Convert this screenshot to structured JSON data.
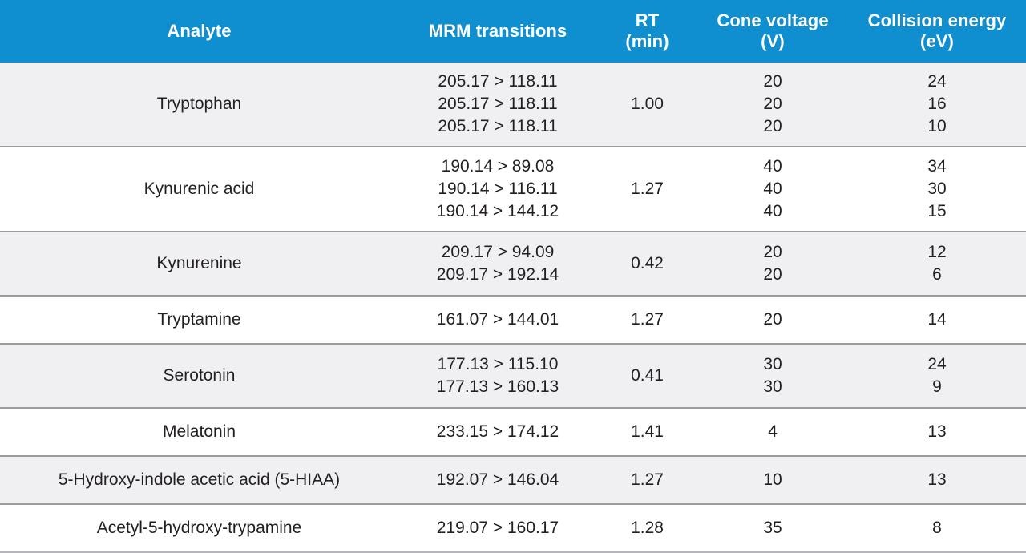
{
  "table": {
    "header": {
      "columns": [
        {
          "label": "Analyte",
          "unit": ""
        },
        {
          "label": "MRM transitions",
          "unit": ""
        },
        {
          "label": "RT",
          "unit": "(min)"
        },
        {
          "label": "Cone voltage",
          "unit": "(V)"
        },
        {
          "label": "Collision energy",
          "unit": "(eV)"
        }
      ]
    },
    "rows": [
      {
        "analyte": "Tryptophan",
        "mrm": [
          "205.17 > 118.11",
          "205.17 > 118.11",
          "205.17 > 118.11"
        ],
        "rt": "1.00",
        "cone_voltage": [
          "20",
          "20",
          "20"
        ],
        "collision_energy": [
          "24",
          "16",
          "10"
        ]
      },
      {
        "analyte": "Kynurenic acid",
        "mrm": [
          "190.14 > 89.08",
          "190.14 > 116.11",
          "190.14 > 144.12"
        ],
        "rt": "1.27",
        "cone_voltage": [
          "40",
          "40",
          "40"
        ],
        "collision_energy": [
          "34",
          "30",
          "15"
        ]
      },
      {
        "analyte": "Kynurenine",
        "mrm": [
          "209.17 > 94.09",
          "209.17 > 192.14"
        ],
        "rt": "0.42",
        "cone_voltage": [
          "20",
          "20"
        ],
        "collision_energy": [
          "12",
          "6"
        ]
      },
      {
        "analyte": "Tryptamine",
        "mrm": [
          "161.07 > 144.01"
        ],
        "rt": "1.27",
        "cone_voltage": [
          "20"
        ],
        "collision_energy": [
          "14"
        ]
      },
      {
        "analyte": "Serotonin",
        "mrm": [
          "177.13 > 115.10",
          "177.13 > 160.13"
        ],
        "rt": "0.41",
        "cone_voltage": [
          "30",
          "30"
        ],
        "collision_energy": [
          "24",
          "9"
        ]
      },
      {
        "analyte": "Melatonin",
        "mrm": [
          "233.15 > 174.12"
        ],
        "rt": "1.41",
        "cone_voltage": [
          "4"
        ],
        "collision_energy": [
          "13"
        ]
      },
      {
        "analyte": "5-Hydroxy-indole acetic acid (5-HIAA)",
        "mrm": [
          "192.07 > 146.04"
        ],
        "rt": "1.27",
        "cone_voltage": [
          "10"
        ],
        "collision_energy": [
          "13"
        ]
      },
      {
        "analyte": "Acetyl-5-hydroxy-trypamine",
        "mrm": [
          "219.07 > 160.17"
        ],
        "rt": "1.28",
        "cone_voltage": [
          "35"
        ],
        "collision_energy": [
          "8"
        ]
      }
    ]
  },
  "colors": {
    "header_background": "#0f8ed0",
    "header_text": "#ffffff",
    "row_shaded": "#f0f0f2",
    "row_plain": "#ffffff",
    "row_divider": "#9b9b9f",
    "body_text": "#231f20"
  }
}
